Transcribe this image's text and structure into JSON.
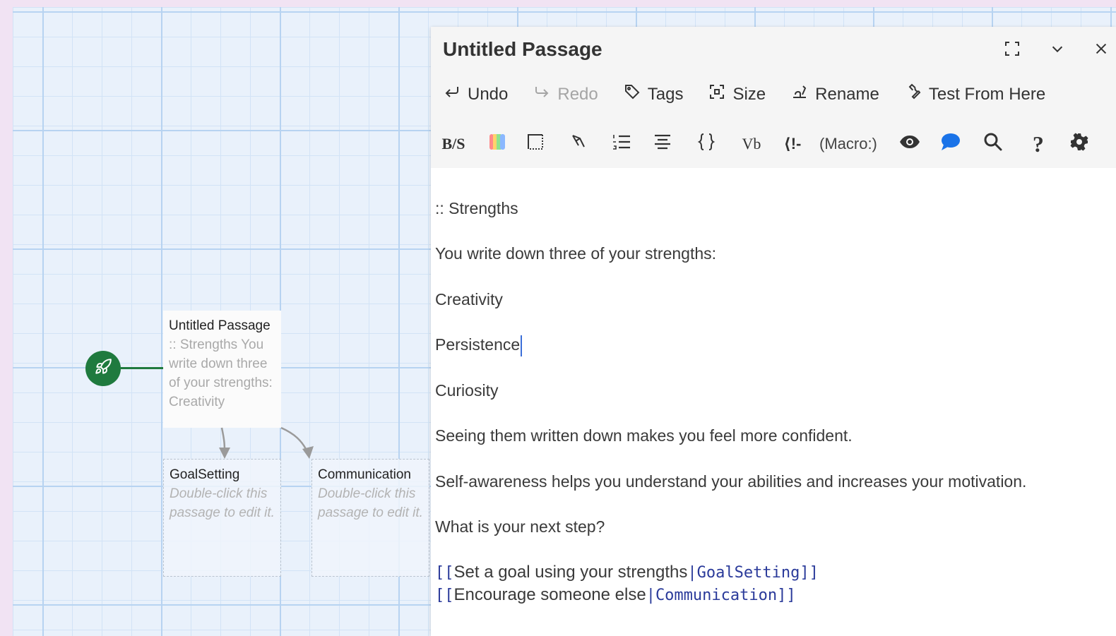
{
  "story_map": {
    "start_node": {
      "icon": "rocket-icon",
      "color": "#1f7a3e"
    },
    "passages": [
      {
        "title": "Untitled Passage",
        "excerpt": ":: Strengths You write down three of your strengths: Creativity"
      },
      {
        "title": "GoalSetting",
        "excerpt": "Double-click this passage to edit it."
      },
      {
        "title": "Communication",
        "excerpt": "Double-click this passage to edit it."
      }
    ]
  },
  "dialog": {
    "title": "Untitled Passage",
    "window_buttons": {
      "maximize": "maximize-icon",
      "collapse": "chevron-down-icon",
      "close": "close-icon"
    },
    "toolbar": {
      "undo": "Undo",
      "redo": "Redo",
      "tags": "Tags",
      "size": "Size",
      "rename": "Rename",
      "test_from_here": "Test From Here"
    },
    "harlowe_toolbar": {
      "styles_label": "B/S",
      "verbatim_label": "Vb",
      "comment_label": "⟨!-",
      "macro_label": "(Macro:)",
      "help_label": "?"
    },
    "editor": {
      "lines": [
        ":: Strengths",
        "You write down three of your strengths:",
        "Creativity",
        "Persistence",
        "Curiosity",
        "Seeing them written down makes you feel more confident.",
        "Self-awareness helps you understand your abilities and increases your motivation.",
        "What is your next step?"
      ],
      "links": [
        {
          "open": "[[",
          "text": "Set a goal using your strengths",
          "sep": "|",
          "target": "GoalSetting",
          "close": "]]"
        },
        {
          "open": "[[",
          "text": "Encourage someone else",
          "sep": "|",
          "target": "Communication",
          "close": "]]"
        }
      ]
    }
  },
  "colors": {
    "accent_blue": "#2a3a9a",
    "start_green": "#1f7a3e",
    "background": "#f1e3f3"
  }
}
